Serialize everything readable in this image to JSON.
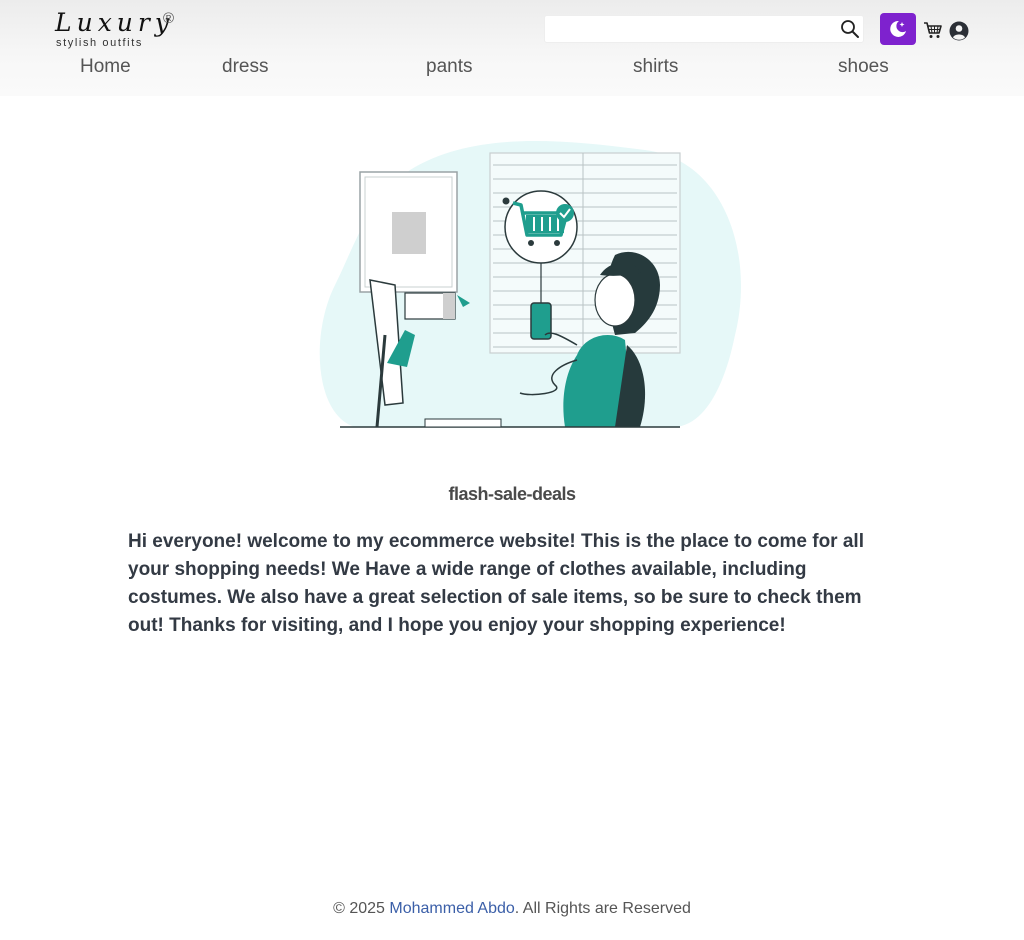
{
  "brand": {
    "logo_text": "Luxury",
    "registered_mark": "®",
    "tagline": "stylish outfits"
  },
  "search": {
    "placeholder": "",
    "value": "",
    "icon": "search-icon"
  },
  "header_actions": {
    "theme_toggle_icon": "moon-stars-icon",
    "cart_icon": "cart-icon",
    "account_icon": "user-circle-icon"
  },
  "nav": {
    "items": [
      {
        "label": "Home"
      },
      {
        "label": "dress"
      },
      {
        "label": "pants"
      },
      {
        "label": "shirts"
      },
      {
        "label": "shoes"
      }
    ]
  },
  "main": {
    "illustration": "online-shopping-illustration",
    "headline": "flash-sale-deals",
    "intro": "Hi everyone! welcome to my ecommerce website! This is the place to come for all your shopping needs! We Have a wide range of clothes available, including costumes. We also have a great selection of sale items, so be sure to check them out! Thanks for visiting, and I hope you enjoy your shopping experience!"
  },
  "footer": {
    "prefix": "© 2025 ",
    "author": "Mohammed Abdo",
    "suffix": ". All Rights are Reserved"
  },
  "colors": {
    "accent_purple": "#7e22ce",
    "illustration_teal": "#1f9e8e",
    "illustration_bg": "#e6f8f8",
    "link_blue": "#3b5fa8"
  }
}
